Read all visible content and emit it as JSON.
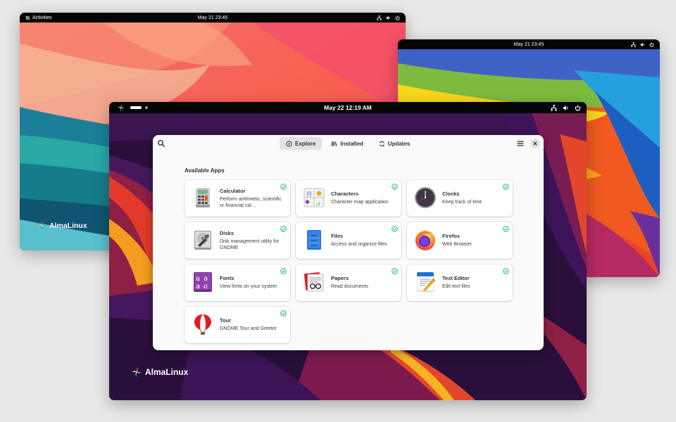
{
  "desktops": {
    "left": {
      "activities": "Activities",
      "clock": "May 21  23:45",
      "brand": "AlmaLinux"
    },
    "right": {
      "clock": "May 21  23:45"
    },
    "front": {
      "clock": "May 22  12:19 AM",
      "brand": "AlmaLinux"
    }
  },
  "software": {
    "tabs": [
      {
        "label": "Explore",
        "icon": "compass-icon",
        "active": true
      },
      {
        "label": "Installed",
        "icon": "library-icon",
        "active": false
      },
      {
        "label": "Updates",
        "icon": "refresh-icon",
        "active": false
      }
    ],
    "section_title": "Available Apps",
    "apps": [
      {
        "name": "Calculator",
        "description": "Perform arithmetic, scientific or financial cal…",
        "icon": "calculator-icon",
        "installed": true
      },
      {
        "name": "Characters",
        "description": "Character map application",
        "icon": "characters-icon",
        "installed": true
      },
      {
        "name": "Clocks",
        "description": "Keep track of time",
        "icon": "clocks-icon",
        "installed": true
      },
      {
        "name": "Disks",
        "description": "Disk management utility for GNOME",
        "icon": "disks-icon",
        "installed": true
      },
      {
        "name": "Files",
        "description": "Access and organize files",
        "icon": "files-icon",
        "installed": true
      },
      {
        "name": "Firefox",
        "description": "Web Browser",
        "icon": "firefox-icon",
        "installed": true
      },
      {
        "name": "Fonts",
        "description": "View fonts on your system",
        "icon": "fonts-icon",
        "installed": true
      },
      {
        "name": "Papers",
        "description": "Read documents",
        "icon": "papers-icon",
        "installed": true
      },
      {
        "name": "Text Editor",
        "description": "Edit text files",
        "icon": "text-editor-icon",
        "installed": true
      },
      {
        "name": "Tour",
        "description": "GNOME Tour and Greeter",
        "icon": "tour-icon",
        "installed": true
      }
    ]
  },
  "colors": {
    "accent_check": "#2ec27e",
    "topbar": "#050505",
    "dialog_bg": "#fafafa"
  }
}
